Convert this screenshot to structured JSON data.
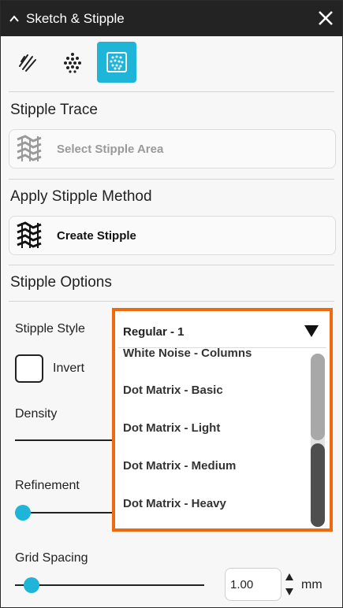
{
  "window": {
    "title": "Sketch & Stipple"
  },
  "tabs": [
    {
      "icon": "sketch-lines-icon",
      "active": false
    },
    {
      "icon": "stipple-dots-icon",
      "active": false
    },
    {
      "icon": "stipple-frame-icon",
      "active": true
    }
  ],
  "stipple_trace": {
    "title": "Stipple Trace",
    "button_label": "Select Stipple Area",
    "enabled": false
  },
  "apply_method": {
    "title": "Apply Stipple Method",
    "button_label": "Create Stipple"
  },
  "options": {
    "title": "Stipple Options",
    "style_label": "Stipple Style",
    "style_value": "Regular - 1",
    "style_options": [
      "White Noise - Columns",
      "Dot Matrix - Basic",
      "Dot Matrix - Light",
      "Dot Matrix - Medium",
      "Dot Matrix - Heavy"
    ],
    "invert_label": "Invert",
    "invert_checked": false,
    "density_label": "Density",
    "refinement_label": "Refinement",
    "grid_spacing_label": "Grid Spacing",
    "grid_spacing_value": "1.00",
    "grid_spacing_unit": "mm"
  },
  "colors": {
    "accent": "#1fb5d8",
    "highlight": "#ee6a0e",
    "titlebar": "#232323"
  }
}
